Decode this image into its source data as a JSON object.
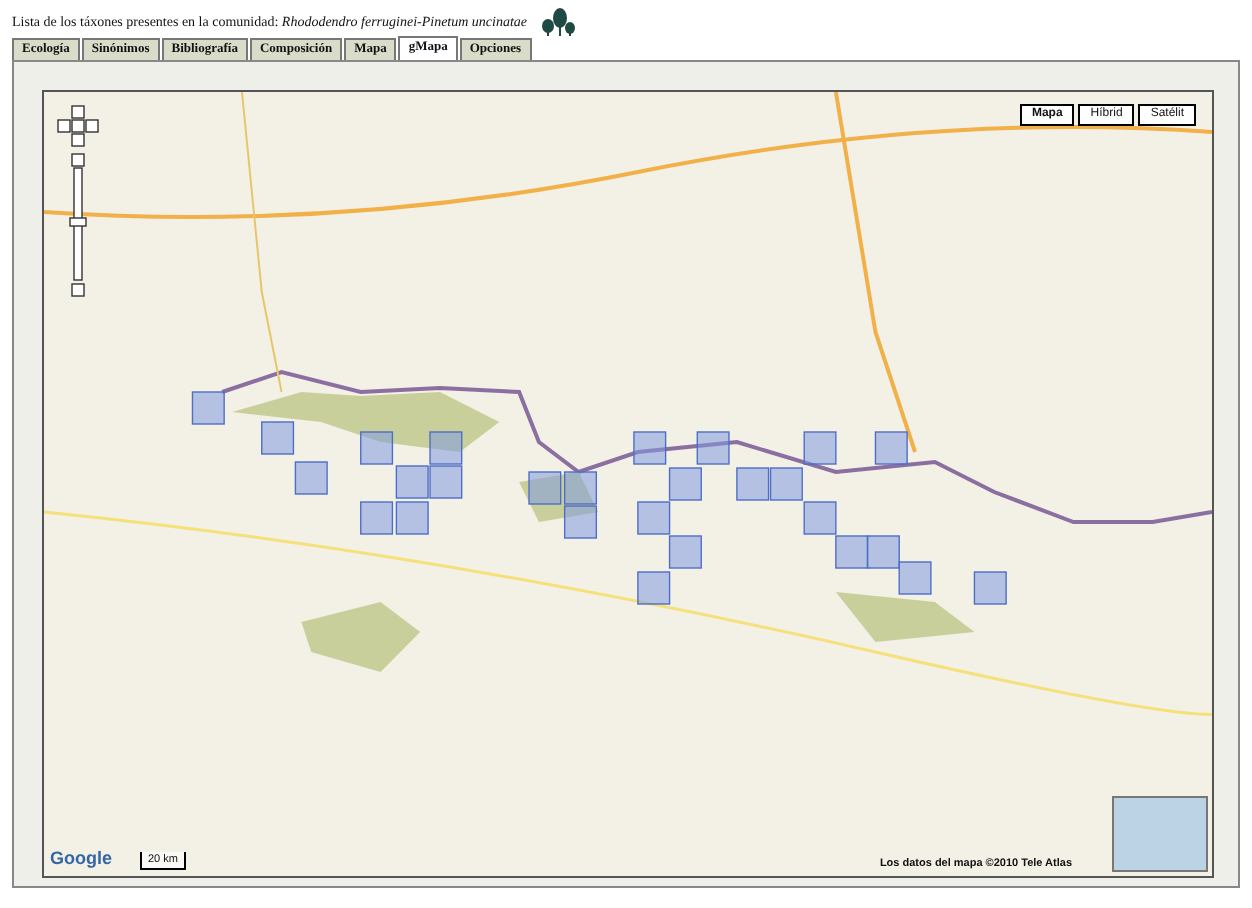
{
  "header": {
    "title": "Lista de los táxones presentes en la comunidad: *Rhododendro ferruginei-Pinetum uncinatae*"
  },
  "tabs": [
    {
      "label": "Ecología",
      "selected": false
    },
    {
      "label": "Sinónimos",
      "selected": false
    },
    {
      "label": "Bibliografía",
      "selected": false
    },
    {
      "label": "Composición",
      "selected": false
    },
    {
      "label": "Mapa",
      "selected": false
    },
    {
      "label": "gMapa",
      "selected": true
    },
    {
      "label": "Opciones",
      "selected": false
    }
  ],
  "map": {
    "map_types": [
      {
        "label": "Mapa",
        "selected": true
      },
      {
        "label": "Híbrid",
        "selected": false
      },
      {
        "label": "Satélit",
        "selected": false
      }
    ],
    "logo": "Google",
    "scale": "20 km",
    "attribution": "Los datos del mapa ©2010 Tele Atlas"
  }
}
